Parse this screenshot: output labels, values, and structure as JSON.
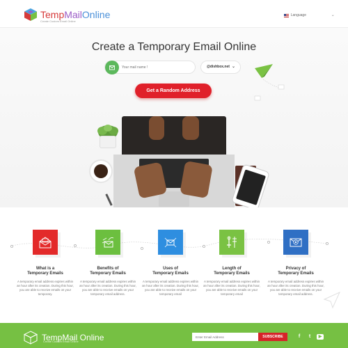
{
  "header": {
    "logo": {
      "temp": "Temp",
      "mail": "Mail",
      "online": "Online",
      "tagline": "Create Custom Email Online"
    },
    "language_label": "Language"
  },
  "hero": {
    "title": "Create a Temporary Email Online",
    "mail_placeholder": "Your mail name !",
    "domain_value": "@dishbox.net",
    "cta_label": "Get a Random Address"
  },
  "features": [
    {
      "title": "What is a\nTemporary Emails",
      "text": "A temporary email address expires within an hour after its creation. During this hour, you are able to receive emails on your temporary.",
      "color": "#e32a2a",
      "icon": "open-envelope-icon"
    },
    {
      "title": "Benefits of\nTemporary Emails",
      "text": "A temporary email address expires within an hour after its creation. During this hour, you are able to receive emails on your temporary email address.",
      "color": "#6cbf3f",
      "icon": "flying-mail-icon"
    },
    {
      "title": "Uses of\nTemporary Emails",
      "text": "A temporary email address expires within an hour after its creation. During this hour, you are able to receive emails on your temporary email",
      "color": "#2e8ee0",
      "icon": "envelope-network-icon"
    },
    {
      "title": "Length of\nTemporary Emails",
      "text": "A temporary email address expires within an hour after its creation. During this hour, you are able to receive emails on your temporary email",
      "color": "#7ac243",
      "icon": "tools-icon"
    },
    {
      "title": "Privacy of\nTemporary Emails",
      "text": "A temporary email address expires within an hour after its creation. During this hour, you are able to receive emails on your temporary email address.",
      "color": "#2f6fc4",
      "icon": "secure-mail-icon"
    }
  ],
  "footer": {
    "logo": {
      "text": "TempMail Online",
      "tagline": "Create Custom Email Online"
    },
    "email_placeholder": "Enter Email Address",
    "subscribe_label": "SUBSCRIBE",
    "social": [
      {
        "label": "f",
        "icon": "facebook-icon"
      },
      {
        "label": "t",
        "icon": "twitter-icon"
      },
      {
        "label": "▶",
        "icon": "youtube-icon"
      }
    ]
  },
  "colors": {
    "accent_red": "#e0202a",
    "footer_green": "#76c043",
    "mail_button_green": "#5cb85c"
  }
}
